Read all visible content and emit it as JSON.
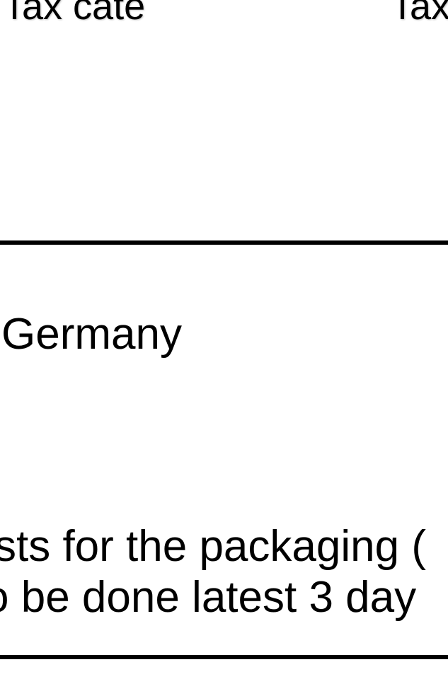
{
  "table": {
    "header": {
      "col1_label": "Tax cate",
      "col2_label": "Tax"
    },
    "row": {
      "country": "Germany"
    }
  },
  "note": {
    "line1": "sts for the packaging (",
    "line2": "o be done latest 3 day"
  }
}
